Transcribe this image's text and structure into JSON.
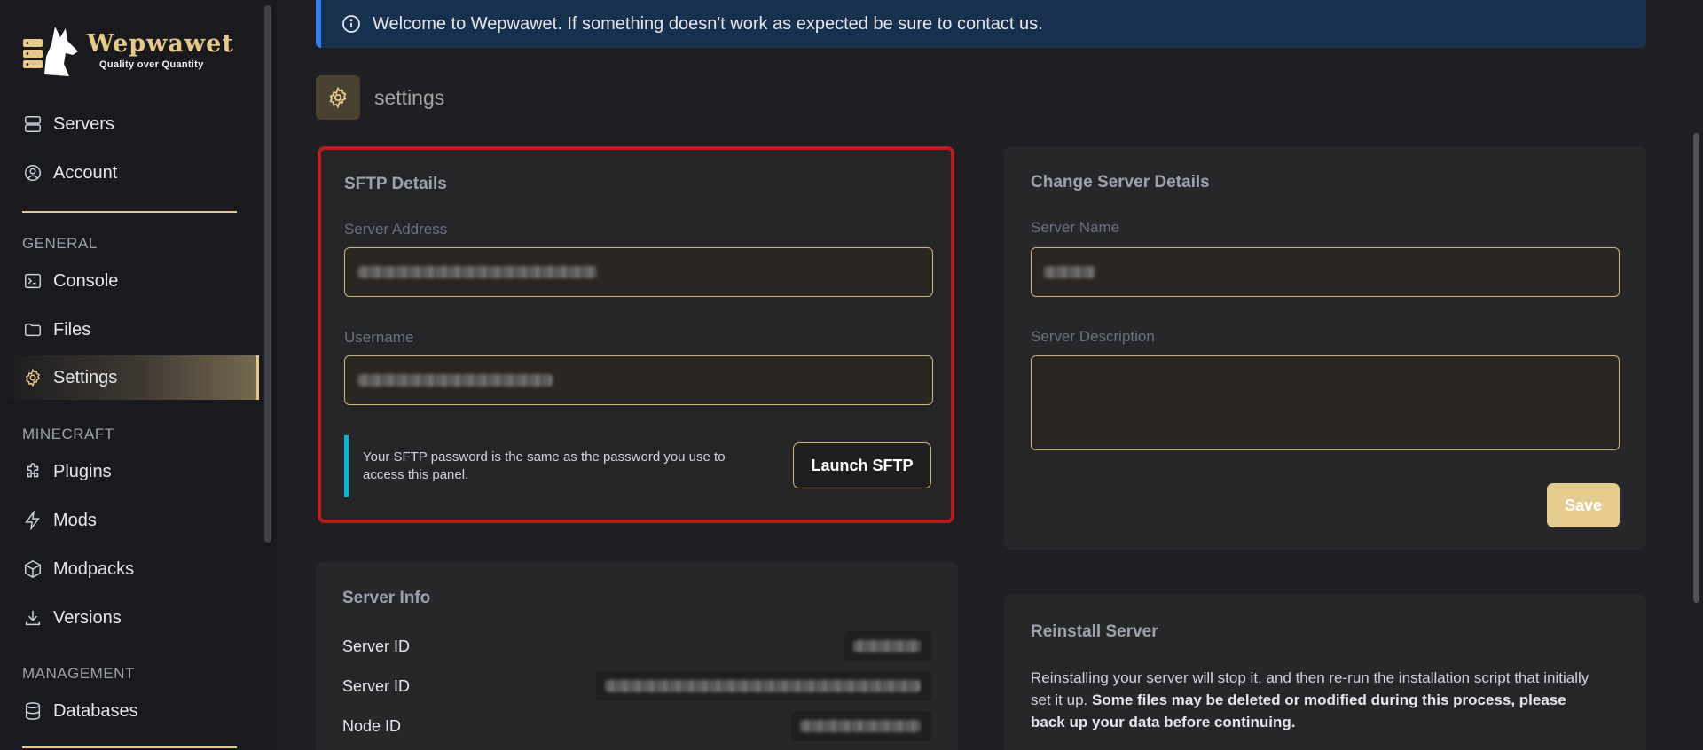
{
  "brand": {
    "name": "Wepwawet",
    "tagline": "Quality over Quantity"
  },
  "sidebar": {
    "top_items": [
      {
        "label": "Servers",
        "icon": "server-icon"
      },
      {
        "label": "Account",
        "icon": "user-circle-icon"
      }
    ],
    "sections": [
      {
        "label": "GENERAL",
        "items": [
          {
            "label": "Console",
            "icon": "terminal-icon"
          },
          {
            "label": "Files",
            "icon": "folder-icon"
          },
          {
            "label": "Settings",
            "icon": "gear-icon",
            "active": true
          }
        ]
      },
      {
        "label": "MINECRAFT",
        "items": [
          {
            "label": "Plugins",
            "icon": "puzzle-icon"
          },
          {
            "label": "Mods",
            "icon": "bolt-icon"
          },
          {
            "label": "Modpacks",
            "icon": "cube-icon"
          },
          {
            "label": "Versions",
            "icon": "download-icon"
          }
        ]
      },
      {
        "label": "MANAGEMENT",
        "items": [
          {
            "label": "Databases",
            "icon": "database-icon"
          }
        ]
      }
    ]
  },
  "banner": {
    "text": "Welcome to Wepwawet. If something doesn't work as expected be sure to contact us."
  },
  "page": {
    "title": "settings"
  },
  "sftp": {
    "title": "SFTP Details",
    "server_address_label": "Server Address",
    "username_label": "Username",
    "note": "Your SFTP password is the same as the password you use to access this panel.",
    "launch_label": "Launch SFTP"
  },
  "details": {
    "title": "Change Server Details",
    "name_label": "Server Name",
    "description_label": "Server Description",
    "save_label": "Save"
  },
  "info": {
    "title": "Server Info",
    "rows": [
      {
        "label": "Server ID"
      },
      {
        "label": "Server ID"
      },
      {
        "label": "Node ID"
      }
    ]
  },
  "reinstall": {
    "title": "Reinstall Server",
    "text": "Reinstalling your server will stop it, and then re-run the installation script that initially set it up.",
    "warning": "Some files may be deleted or modified during this process, please back up your data before continuing."
  },
  "colors": {
    "accent": "#e6c889",
    "highlight_border": "#b91c1c",
    "note_bar": "#06b6d4",
    "banner_bg": "#16314f"
  }
}
